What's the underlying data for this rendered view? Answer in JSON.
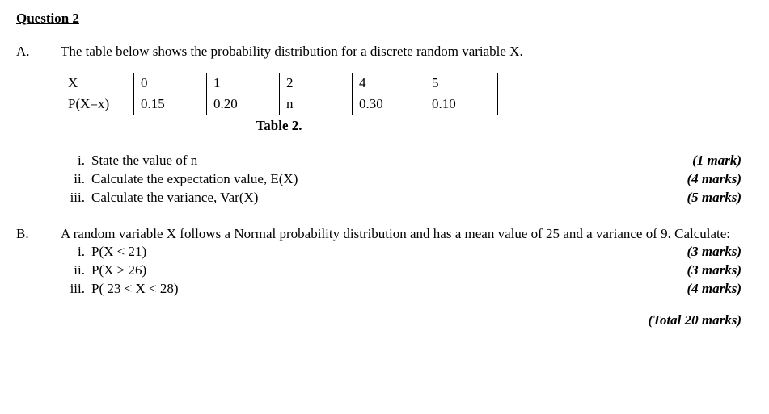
{
  "heading": "Question 2",
  "partA": {
    "label": "A.",
    "intro": "The table below shows the probability distribution for a discrete random variable X.",
    "table": {
      "row1": [
        "X",
        "0",
        "1",
        "2",
        "4",
        "5"
      ],
      "row2": [
        "P(X=x)",
        "0.15",
        "0.20",
        "n",
        "0.30",
        "0.10"
      ]
    },
    "caption": "Table 2.",
    "items": [
      {
        "num": "i.",
        "text": "State the value of n",
        "marks": "(1 mark)"
      },
      {
        "num": "ii.",
        "text": "Calculate the expectation value, E(X)",
        "marks": "(4 marks)"
      },
      {
        "num": "iii.",
        "text": "Calculate the variance, Var(X)",
        "marks": "(5 marks)"
      }
    ]
  },
  "partB": {
    "label": "B.",
    "intro": "A random variable X follows a Normal probability distribution and has a mean value of 25 and a variance of 9. Calculate:",
    "items": [
      {
        "num": "i.",
        "text": "P(X < 21)",
        "marks": "(3 marks)"
      },
      {
        "num": "ii.",
        "text": "P(X > 26)",
        "marks": "(3 marks)"
      },
      {
        "num": "iii.",
        "text": "P( 23 < X < 28)",
        "marks": "(4 marks)"
      }
    ]
  },
  "total": "(Total 20 marks)"
}
